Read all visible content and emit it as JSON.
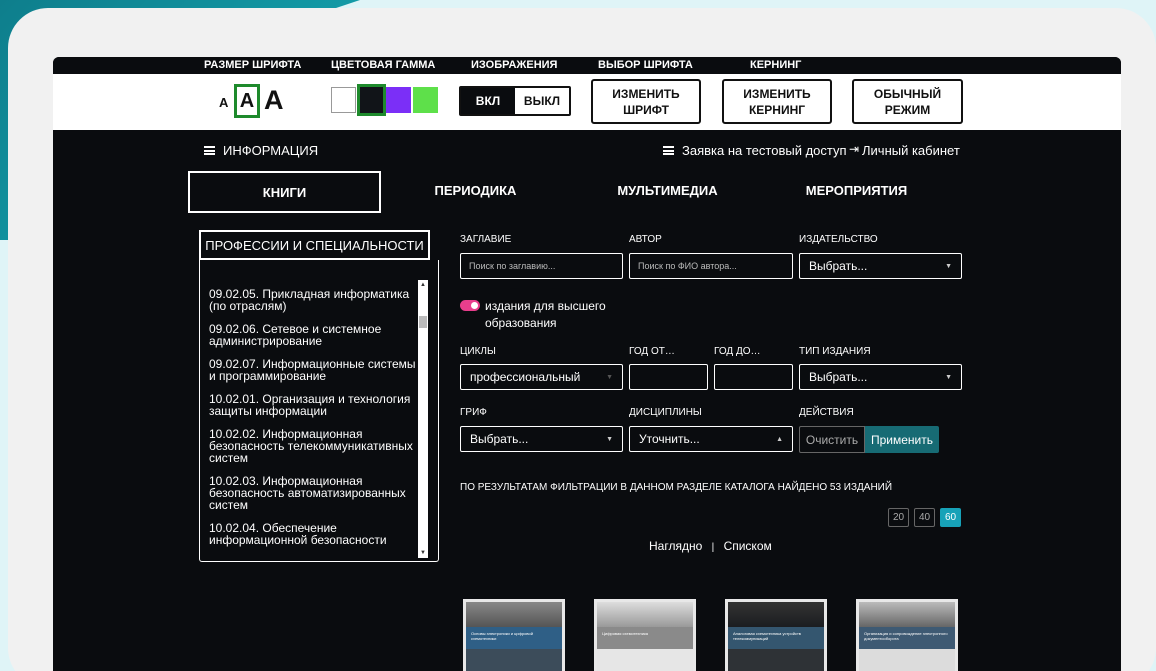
{
  "accessibility": {
    "labels": {
      "font_size": "РАЗМЕР ШРИФТА",
      "color_scheme": "ЦВЕТОВАЯ ГАММА",
      "images": "ИЗОБРАЖЕНИЯ",
      "font_choice": "ВЫБОР ШРИФТА",
      "kerning": "КЕРНИНГ"
    },
    "font_sizes": [
      "A",
      "A",
      "A"
    ],
    "color_swatches": [
      "#ffffff",
      "#111418",
      "#7b2ff7",
      "#5ee04a"
    ],
    "images_on": "ВКЛ",
    "images_off": "ВЫКЛ",
    "change_font": "ИЗМЕНИТЬ ШРИФТ",
    "change_kerning": "ИЗМЕНИТЬ КЕРНИНГ",
    "normal_mode": "ОБЫЧНЫЙ РЕЖИМ"
  },
  "nav": {
    "info": "ИНФОРМАЦИЯ",
    "test_access": "Заявка на тестовый доступ",
    "cabinet": "Личный кабинет"
  },
  "tabs": [
    "КНИГИ",
    "ПЕРИОДИКА",
    "МУЛЬТИМЕДИА",
    "МЕРОПРИЯТИЯ"
  ],
  "professions": {
    "title": "ПРОФЕССИИ И СПЕЦИАЛЬНОСТИ",
    "items": [
      "09.02.05. Прикладная информатика (по отраслям)",
      "09.02.06. Сетевое и системное администрирование",
      "09.02.07. Информационные системы и программирование",
      "10.02.01. Организация и технология защиты информации",
      "10.02.02. Информационная безопасность телекоммуникативных систем",
      "10.02.03. Информационная безопасность автоматизированных систем",
      "10.02.04. Обеспечение информационной безопасности"
    ]
  },
  "filters": {
    "title_label": "ЗАГЛАВИЕ",
    "title_placeholder": "Поиск по заглавию...",
    "author_label": "АВТОР",
    "author_placeholder": "Поиск по ФИО автора...",
    "publisher_label": "ИЗДАТЕЛЬСТВО",
    "publisher_value": "Выбрать...",
    "higher_ed_toggle": "издания для высшего образования",
    "cycles_label": "ЦИКЛЫ",
    "cycles_value": "профессиональный",
    "year_from_label": "ГОД ОТ…",
    "year_to_label": "ГОД ДО…",
    "edition_type_label": "ТИП ИЗДАНИЯ",
    "edition_type_value": "Выбрать...",
    "grif_label": "ГРИФ",
    "grif_value": "Выбрать...",
    "disciplines_label": "ДИСЦИПЛИНЫ",
    "disciplines_value": "Уточнить...",
    "actions_label": "ДЕЙСТВИЯ",
    "clear": "Очистить",
    "apply": "Применить"
  },
  "results": {
    "found_text": "ПО РЕЗУЛЬТАТАМ ФИЛЬТРАЦИИ В ДАННОМ РАЗДЕЛЕ КАТАЛОГА НАЙДЕНО 53 ИЗДАНИЙ",
    "page_sizes": [
      "20",
      "40",
      "60"
    ],
    "view_visual": "Наглядно",
    "view_separator": "|",
    "view_list": "Списком"
  },
  "books": [
    {
      "title": "Основы электроники и цифровой схемотехники"
    },
    {
      "title": "Цифровая схемотехника"
    },
    {
      "title": "Аналоговая схемотехника устройств телекоммуникаций"
    },
    {
      "title": "Организация и сопровождение электронного документооборота"
    }
  ]
}
